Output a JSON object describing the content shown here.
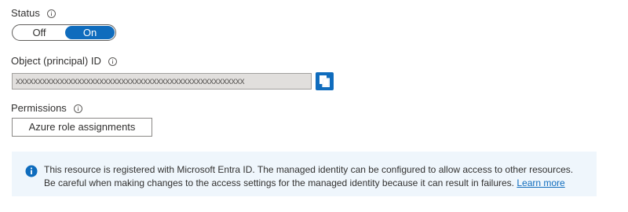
{
  "status": {
    "label": "Status",
    "info_icon": "info-icon",
    "toggle": {
      "off_label": "Off",
      "on_label": "On",
      "selected": "On",
      "accent_color": "#0f6cbd"
    }
  },
  "object_id": {
    "label": "Object (principal) ID",
    "info_icon": "info-icon",
    "value": "xxxxxxxxxxxxxxxxxxxxxxxxxxxxxxxxxxxxxxxxxxxxxxxxxxxx",
    "copy_icon": "copy-icon"
  },
  "permissions": {
    "label": "Permissions",
    "info_icon": "info-icon",
    "button_label": "Azure role assignments"
  },
  "banner": {
    "icon": "info-filled-icon",
    "line1": "This resource is registered with Microsoft Entra ID. The managed identity can be configured to allow access to other resources.",
    "line2": "Be careful when making changes to the access settings for the managed identity because it can result in failures.",
    "link_label": "Learn more",
    "background_color": "#eff6fc"
  }
}
